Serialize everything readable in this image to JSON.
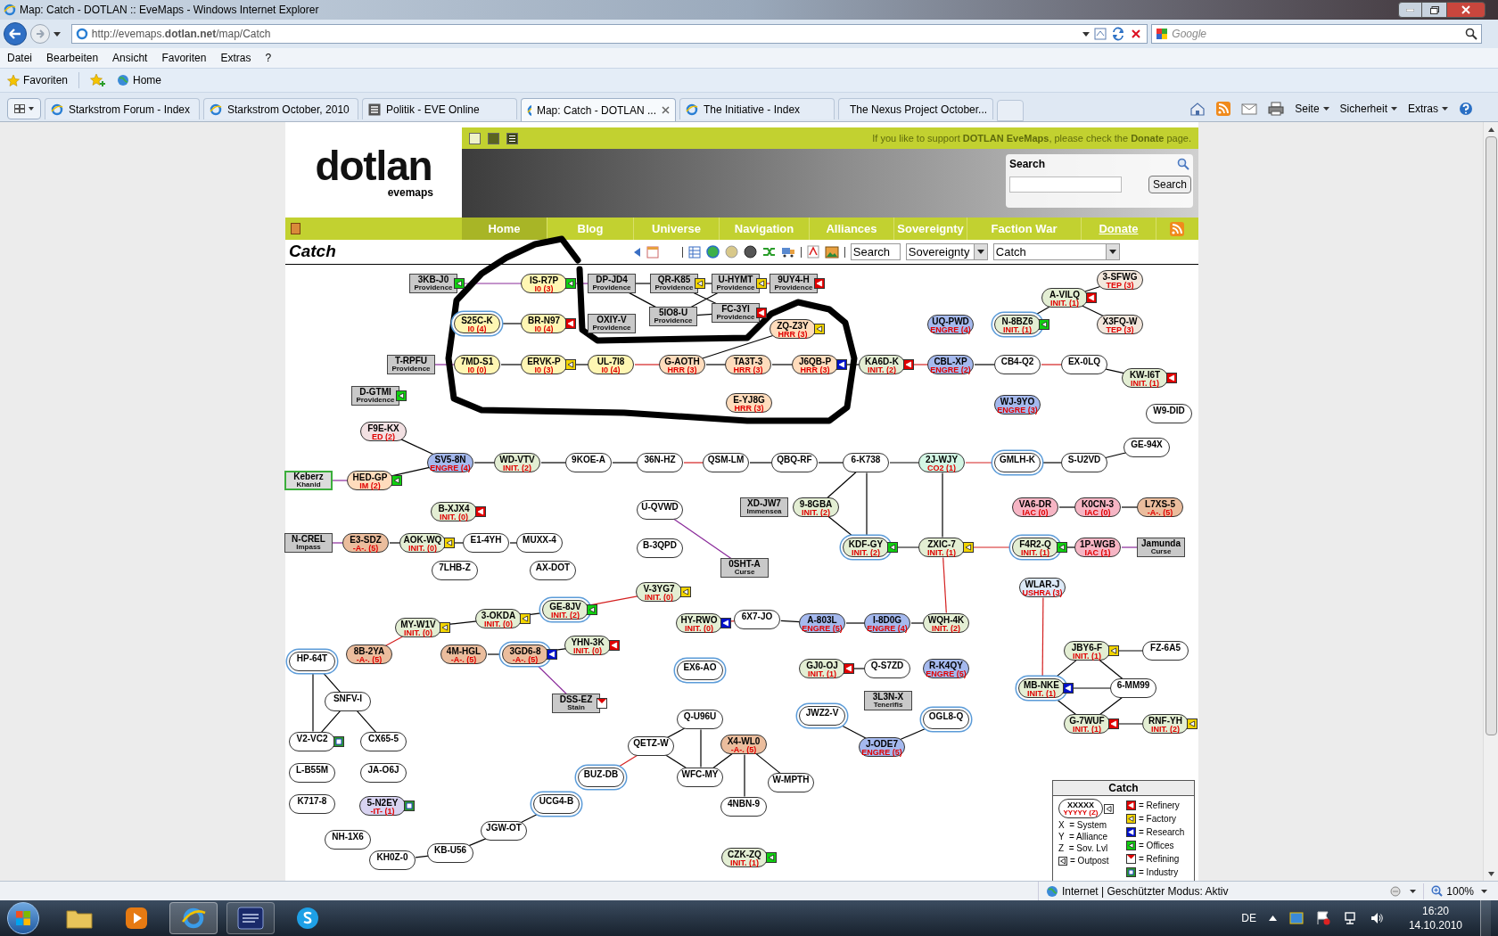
{
  "window": {
    "title": "Map: Catch - DOTLAN :: EveMaps - Windows Internet Explorer"
  },
  "address_bar": {
    "url": "http://evemaps.**dotlan.net**/map/Catch",
    "search_placeholder": "Google"
  },
  "menu": [
    "Datei",
    "Bearbeiten",
    "Ansicht",
    "Favoriten",
    "Extras",
    "?"
  ],
  "favorites_bar": {
    "favorites": "Favoriten",
    "links": [
      "Home"
    ]
  },
  "tabs": [
    {
      "label": "Starkstrom Forum - Index",
      "selected": false,
      "kind": "ie"
    },
    {
      "label": "Starkstrom October, 2010",
      "selected": false,
      "kind": "ie"
    },
    {
      "label": "Politik - EVE Online",
      "selected": false,
      "kind": "forum"
    },
    {
      "label": "Map: Catch - DOTLAN ...",
      "selected": true,
      "kind": "ie"
    },
    {
      "label": "The Initiative - Index",
      "selected": false,
      "kind": "ie"
    },
    {
      "label": "The Nexus Project October...",
      "selected": false,
      "kind": "game"
    }
  ],
  "command_bar": [
    "Seite",
    "Sicherheit",
    "Extras"
  ],
  "page": {
    "support_note": "If you like to support **DOTLAN EveMaps**, please check the **Donate** page.",
    "logo": {
      "name": "dotlan",
      "tagline": "evemaps"
    },
    "search": {
      "label": "Search",
      "button": "Search"
    },
    "nav": [
      {
        "label": "Home",
        "selected": true,
        "kind": "section"
      },
      {
        "label": "Blog",
        "selected": false,
        "kind": "section"
      },
      {
        "label": "Universe",
        "selected": false,
        "kind": "section"
      },
      {
        "label": "Navigation",
        "selected": false,
        "kind": "section"
      },
      {
        "label": "Alliances",
        "selected": false,
        "kind": "section"
      },
      {
        "label": "Sovereignty",
        "selected": false,
        "kind": "section"
      },
      {
        "label": "Faction War",
        "selected": false,
        "kind": "section"
      },
      {
        "label": "Donate",
        "selected": false,
        "kind": "link"
      }
    ],
    "heading": "Catch",
    "toolbar": {
      "search_value": "Search",
      "mode": "Sovereignty",
      "region": "Catch"
    },
    "map": {
      "systems": [
        {
          "name": "3KB-J0",
          "kind": "region",
          "region": "Providence",
          "station": {
            "kind": "offices"
          }
        },
        {
          "name": "IS-R7P",
          "kind": "system",
          "alliance": "I0 (3)",
          "color": "#fff6b3",
          "station": {
            "kind": "offices"
          },
          "outpost": false
        },
        {
          "name": "DP-JD4",
          "kind": "region",
          "region": "Providence"
        },
        {
          "name": "QR-K85",
          "kind": "region",
          "region": "Providence",
          "station": {
            "kind": "factory"
          }
        },
        {
          "name": "U-HYMT",
          "kind": "region",
          "region": "Providence",
          "station": {
            "kind": "factory"
          }
        },
        {
          "name": "9UY4-H",
          "kind": "region",
          "region": "Providence",
          "station": {
            "kind": "refinery"
          }
        },
        {
          "name": "S25C-K",
          "kind": "system",
          "alliance": "I0 (4)",
          "color": "#fff6b3",
          "outpost": true
        },
        {
          "name": "BR-N97",
          "kind": "system",
          "alliance": "I0 (4)",
          "color": "#fff6b3",
          "station": {
            "kind": "refinery"
          },
          "outpost": false
        },
        {
          "name": "OXIY-V",
          "kind": "region",
          "region": "Providence"
        },
        {
          "name": "5IO8-U",
          "kind": "region",
          "region": "Providence"
        },
        {
          "name": "FC-3YI",
          "kind": "region",
          "region": "Providence",
          "station": {
            "kind": "refinery"
          }
        },
        {
          "name": "ZQ-Z3Y",
          "kind": "system",
          "alliance": "HRR (3)",
          "color": "#ffdcbc",
          "station": {
            "kind": "factory"
          },
          "outpost": false
        },
        {
          "name": "T-RPFU",
          "kind": "region",
          "region": "Providence"
        },
        {
          "name": "7MD-S1",
          "kind": "system",
          "alliance": "I0 (0)",
          "color": "#fff6b3",
          "outpost": false
        },
        {
          "name": "ERVK-P",
          "kind": "system",
          "alliance": "I0 (3)",
          "color": "#fff6b3",
          "station": {
            "kind": "factory"
          },
          "outpost": false
        },
        {
          "name": "UL-7I8",
          "kind": "system",
          "alliance": "I0 (4)",
          "color": "#fff6b3",
          "outpost": false
        },
        {
          "name": "G-AOTH",
          "kind": "system",
          "alliance": "HRR (3)",
          "color": "#ffdcbc",
          "outpost": false
        },
        {
          "name": "TA3T-3",
          "kind": "system",
          "alliance": "HRR (3)",
          "color": "#ffdcbc",
          "outpost": false
        },
        {
          "name": "J6QB-P",
          "kind": "system",
          "alliance": "HRR (3)",
          "color": "#ffdcbc",
          "station": {
            "kind": "research"
          },
          "outpost": false
        },
        {
          "name": "E-YJ8G",
          "kind": "system",
          "alliance": "HRR (3)",
          "color": "#ffdcbc",
          "outpost": false
        },
        {
          "name": "KA6D-K",
          "kind": "system",
          "alliance": "INIT. (2)",
          "color": "#e3eed3",
          "station": {
            "kind": "refinery"
          },
          "outpost": false
        },
        {
          "name": "UQ-PWD",
          "kind": "system",
          "alliance": "ENGRE (4)",
          "color": "#a5b9ee",
          "outpost": false
        },
        {
          "name": "CBL-XP",
          "kind": "system",
          "alliance": "ENGRE (2)",
          "color": "#a5b9ee",
          "outpost": false
        },
        {
          "name": "N-8BZ6",
          "kind": "system",
          "alliance": "INIT. (1)",
          "color": "#e3eed3",
          "station": {
            "kind": "offices"
          },
          "outpost": true
        },
        {
          "name": "CB4-Q2",
          "kind": "system",
          "outpost": false
        },
        {
          "name": "WJ-9YO",
          "kind": "system",
          "alliance": "ENGRE (3)",
          "color": "#a5b9ee",
          "outpost": false
        },
        {
          "name": "EX-0LQ",
          "kind": "system",
          "outpost": false
        },
        {
          "name": "A-VILQ",
          "kind": "system",
          "alliance": "INIT. (1)",
          "color": "#e3eed3",
          "station": {
            "kind": "refinery"
          },
          "outpost": false
        },
        {
          "name": "3-SFWG",
          "kind": "system",
          "alliance": "TEP (3)",
          "color": "#f3e7dc",
          "outpost": false
        },
        {
          "name": "X3FQ-W",
          "kind": "system",
          "alliance": "TEP (3)",
          "color": "#f3e7dc",
          "outpost": false
        },
        {
          "name": "KW-I6T",
          "kind": "system",
          "alliance": "INIT. (1)",
          "color": "#e3eed3",
          "station": {
            "kind": "refinery"
          },
          "outpost": false
        },
        {
          "name": "W9-DID",
          "kind": "system",
          "outpost": false
        },
        {
          "name": "GE-94X",
          "kind": "system",
          "outpost": false
        },
        {
          "name": "SV5-8N",
          "kind": "system",
          "alliance": "ENGRE (4)",
          "color": "#a5b9ee",
          "outpost": false
        },
        {
          "name": "WD-VTV",
          "kind": "system",
          "alliance": "INIT. (2)",
          "color": "#e3eed3",
          "outpost": false
        },
        {
          "name": "9KOE-A",
          "kind": "system",
          "outpost": false
        },
        {
          "name": "36N-HZ",
          "kind": "system",
          "outpost": false
        },
        {
          "name": "QSM-LM",
          "kind": "system",
          "outpost": false
        },
        {
          "name": "QBQ-RF",
          "kind": "system",
          "outpost": false
        },
        {
          "name": "6-K738",
          "kind": "system",
          "outpost": false
        },
        {
          "name": "2J-WJY",
          "kind": "system",
          "alliance": "CO2 (1)",
          "color": "#d3f6e4",
          "outpost": false
        },
        {
          "name": "GMLH-K",
          "kind": "system",
          "outpost": true
        },
        {
          "name": "S-U2VD",
          "kind": "system",
          "outpost": false
        },
        {
          "name": "D-GTMI",
          "kind": "region",
          "region": "Providence",
          "station": {
            "kind": "offices"
          }
        },
        {
          "name": "F9E-KX",
          "kind": "system",
          "alliance": "ED (2)",
          "color": "#f2e0e2",
          "outpost": false
        },
        {
          "name": "Keberz",
          "kind": "faction",
          "region": "Khanid"
        },
        {
          "name": "HED-GP",
          "kind": "system",
          "alliance": "IM (2)",
          "color": "#ffdcbc",
          "station": {
            "kind": "offices"
          },
          "outpost": false
        },
        {
          "name": "U-QVWD",
          "kind": "system",
          "outpost": false
        },
        {
          "name": "XD-JW7",
          "kind": "region",
          "region": "Immensea"
        },
        {
          "name": "9-8GBA",
          "kind": "system",
          "alliance": "INIT. (2)",
          "color": "#e3eed3",
          "outpost": false
        },
        {
          "name": "B-XJX4",
          "kind": "system",
          "alliance": "INIT. (0)",
          "color": "#e3eed3",
          "station": {
            "kind": "refinery"
          },
          "outpost": false
        },
        {
          "name": "N-CREL",
          "kind": "region",
          "region": "Impass"
        },
        {
          "name": "E3-SDZ",
          "kind": "system",
          "alliance": "-A-. (5)",
          "color": "#ebbd9d",
          "outpost": false
        },
        {
          "name": "AOK-WQ",
          "kind": "system",
          "alliance": "INIT. (0)",
          "color": "#e3eed3",
          "station": {
            "kind": "factory"
          },
          "outpost": false
        },
        {
          "name": "E1-4YH",
          "kind": "system",
          "outpost": false
        },
        {
          "name": "MUXX-4",
          "kind": "system",
          "outpost": false
        },
        {
          "name": "B-3QPD",
          "kind": "system",
          "outpost": false
        },
        {
          "name": "0SHT-A",
          "kind": "region",
          "region": "Curse"
        },
        {
          "name": "KDF-GY",
          "kind": "system",
          "alliance": "INIT. (2)",
          "color": "#e3eed3",
          "station": {
            "kind": "offices"
          },
          "outpost": true
        },
        {
          "name": "ZXIC-7",
          "kind": "system",
          "alliance": "INIT. (1)",
          "color": "#e3eed3",
          "station": {
            "kind": "factory"
          },
          "outpost": false
        },
        {
          "name": "VA6-DR",
          "kind": "system",
          "alliance": "IAC (0)",
          "color": "#f6b5c4",
          "outpost": false
        },
        {
          "name": "K0CN-3",
          "kind": "system",
          "alliance": "IAC (0)",
          "color": "#f6b5c4",
          "outpost": false
        },
        {
          "name": "L7XS-5",
          "kind": "system",
          "alliance": "-A-. (5)",
          "color": "#ebbd9d",
          "outpost": false
        },
        {
          "name": "F4R2-Q",
          "kind": "system",
          "alliance": "INIT. (1)",
          "color": "#e3eed3",
          "station": {
            "kind": "offices"
          },
          "outpost": true
        },
        {
          "name": "1P-WGB",
          "kind": "system",
          "alliance": "IAC (1)",
          "color": "#f6b5c4",
          "outpost": false
        },
        {
          "name": "Jamunda",
          "kind": "region",
          "region": "Curse"
        },
        {
          "name": "7LHB-Z",
          "kind": "system",
          "outpost": false
        },
        {
          "name": "AX-DOT",
          "kind": "system",
          "outpost": false
        },
        {
          "name": "MY-W1V",
          "kind": "system",
          "alliance": "INIT. (0)",
          "color": "#e3eed3",
          "station": {
            "kind": "factory"
          },
          "outpost": false
        },
        {
          "name": "3-OKDA",
          "kind": "system",
          "alliance": "INIT. (0)",
          "color": "#e3eed3",
          "station": {
            "kind": "factory"
          },
          "outpost": false
        },
        {
          "name": "GE-8JV",
          "kind": "system",
          "alliance": "INIT. (2)",
          "color": "#e3eed3",
          "station": {
            "kind": "offices"
          },
          "outpost": true
        },
        {
          "name": "V-3YG7",
          "kind": "system",
          "alliance": "INIT. (0)",
          "color": "#e3eed3",
          "station": {
            "kind": "factory"
          },
          "outpost": false
        },
        {
          "name": "WLAR-J",
          "kind": "system",
          "alliance": "USHRA (3)",
          "color": "#dce9f7",
          "outpost": false
        },
        {
          "name": "HY-RWO",
          "kind": "system",
          "alliance": "INIT. (0)",
          "color": "#e3eed3",
          "station": {
            "kind": "research"
          },
          "outpost": false
        },
        {
          "name": "6X7-JO",
          "kind": "system",
          "outpost": false
        },
        {
          "name": "A-803L",
          "kind": "system",
          "alliance": "ENGRE (5)",
          "color": "#a5b9ee",
          "outpost": false
        },
        {
          "name": "I-8D0G",
          "kind": "system",
          "alliance": "ENGRE (4)",
          "color": "#a5b9ee",
          "outpost": false
        },
        {
          "name": "WQH-4K",
          "kind": "system",
          "alliance": "INIT. (2)",
          "color": "#e3eed3",
          "outpost": false
        },
        {
          "name": "HP-64T",
          "kind": "system",
          "outpost": true
        },
        {
          "name": "8B-2YA",
          "kind": "system",
          "alliance": "-A-. (5)",
          "color": "#ebbd9d",
          "outpost": false
        },
        {
          "name": "4M-HGL",
          "kind": "system",
          "alliance": "-A-. (5)",
          "color": "#ebbd9d",
          "outpost": false
        },
        {
          "name": "3GD6-8",
          "kind": "system",
          "alliance": "-A-. (5)",
          "color": "#ebbd9d",
          "station": {
            "kind": "research"
          },
          "outpost": true
        },
        {
          "name": "YHN-3K",
          "kind": "system",
          "alliance": "INIT. (0)",
          "color": "#e3eed3",
          "station": {
            "kind": "refinery"
          },
          "outpost": false
        },
        {
          "name": "EX6-AO",
          "kind": "system",
          "outpost": true
        },
        {
          "name": "GJ0-OJ",
          "kind": "system",
          "alliance": "INIT. (1)",
          "color": "#e3eed3",
          "station": {
            "kind": "refinery"
          },
          "outpost": false
        },
        {
          "name": "Q-S7ZD",
          "kind": "system",
          "outpost": false
        },
        {
          "name": "R-K4QY",
          "kind": "system",
          "alliance": "ENGRE (5)",
          "color": "#a5b9ee",
          "outpost": false
        },
        {
          "name": "JBY6-F",
          "kind": "system",
          "alliance": "INIT. (1)",
          "color": "#e3eed3",
          "station": {
            "kind": "factory"
          },
          "outpost": false
        },
        {
          "name": "FZ-6A5",
          "kind": "system",
          "outpost": false
        },
        {
          "name": "SNFV-I",
          "kind": "system",
          "outpost": false
        },
        {
          "name": "DSS-EZ",
          "kind": "region",
          "region": "Stain",
          "station": {
            "kind": "refining"
          }
        },
        {
          "name": "Q-U96U",
          "kind": "system",
          "outpost": false
        },
        {
          "name": "JWZ2-V",
          "kind": "system",
          "outpost": true
        },
        {
          "name": "3L3N-X",
          "kind": "region",
          "region": "Tenerifis"
        },
        {
          "name": "OGL8-Q",
          "kind": "system",
          "outpost": true
        },
        {
          "name": "MB-NKE",
          "kind": "system",
          "alliance": "INIT. (1)",
          "color": "#e3eed3",
          "station": {
            "kind": "research"
          },
          "outpost": true
        },
        {
          "name": "G-7WUF",
          "kind": "system",
          "alliance": "INIT. (1)",
          "color": "#e3eed3",
          "station": {
            "kind": "refinery"
          },
          "outpost": false
        },
        {
          "name": "6-MM99",
          "kind": "system",
          "outpost": false
        },
        {
          "name": "RNF-YH",
          "kind": "system",
          "alliance": "INIT. (2)",
          "color": "#e3eed3",
          "station": {
            "kind": "factory"
          },
          "outpost": false
        },
        {
          "name": "V2-VC2",
          "kind": "system",
          "station": {
            "kind": "industry"
          },
          "outpost": false
        },
        {
          "name": "CX65-5",
          "kind": "system",
          "outpost": false
        },
        {
          "name": "QETZ-W",
          "kind": "system",
          "outpost": false
        },
        {
          "name": "X4-WL0",
          "kind": "system",
          "alliance": "-A-. (5)",
          "color": "#ebbd9d",
          "outpost": false
        },
        {
          "name": "J-ODE7",
          "kind": "system",
          "alliance": "ENGRE (5)",
          "color": "#a5b9ee",
          "outpost": false
        },
        {
          "name": "L-B55M",
          "kind": "system",
          "outpost": false
        },
        {
          "name": "JA-O6J",
          "kind": "system",
          "outpost": false
        },
        {
          "name": "BUZ-DB",
          "kind": "system",
          "outpost": true
        },
        {
          "name": "WFC-MY",
          "kind": "system",
          "outpost": false
        },
        {
          "name": "W-MPTH",
          "kind": "system",
          "outpost": false
        },
        {
          "name": "K717-8",
          "kind": "system",
          "outpost": false
        },
        {
          "name": "5-N2EY",
          "kind": "system",
          "alliance": "-IT- (1)",
          "color": "#d8d3f1",
          "station": {
            "kind": "industry"
          },
          "outpost": false
        },
        {
          "name": "UCG4-B",
          "kind": "system",
          "outpost": true
        },
        {
          "name": "4NBN-9",
          "kind": "system",
          "outpost": false
        },
        {
          "name": "NH-1X6",
          "kind": "system",
          "outpost": false
        },
        {
          "name": "JGW-OT",
          "kind": "system",
          "outpost": false
        },
        {
          "name": "KH0Z-0",
          "kind": "system",
          "outpost": false
        },
        {
          "name": "KB-U56",
          "kind": "system",
          "outpost": false
        },
        {
          "name": "CZK-ZQ",
          "kind": "system",
          "alliance": "INIT. (1)",
          "color": "#e3eed3",
          "station": {
            "kind": "offices"
          },
          "outpost": false
        }
      ],
      "legend": {
        "title": "Catch",
        "sample": {
          "name": "XXXXX",
          "alliance": "YYYYY (Z)"
        },
        "keys": [
          "X  = System",
          "Y  = Alliance",
          "Z  = Sov. Lvl"
        ],
        "outpost": "= Outpost",
        "stations": [
          {
            "label": "= Refinery",
            "station": {
              "kind": "refinery"
            }
          },
          {
            "label": "= Factory",
            "station": {
              "kind": "factory"
            }
          },
          {
            "label": "= Research",
            "station": {
              "kind": "research"
            }
          },
          {
            "label": "= Offices",
            "station": {
              "kind": "offices"
            }
          },
          {
            "label": "= Refining",
            "station": {
              "kind": "refining"
            }
          },
          {
            "label": "= Industry",
            "station": {
              "kind": "industry"
            }
          }
        ]
      }
    }
  },
  "status_bar": {
    "zone": "Internet | Geschützter Modus: Aktiv",
    "zoom": "100%"
  },
  "taskbar": {
    "language": "DE",
    "time": "16:20",
    "date": "14.10.2010"
  }
}
